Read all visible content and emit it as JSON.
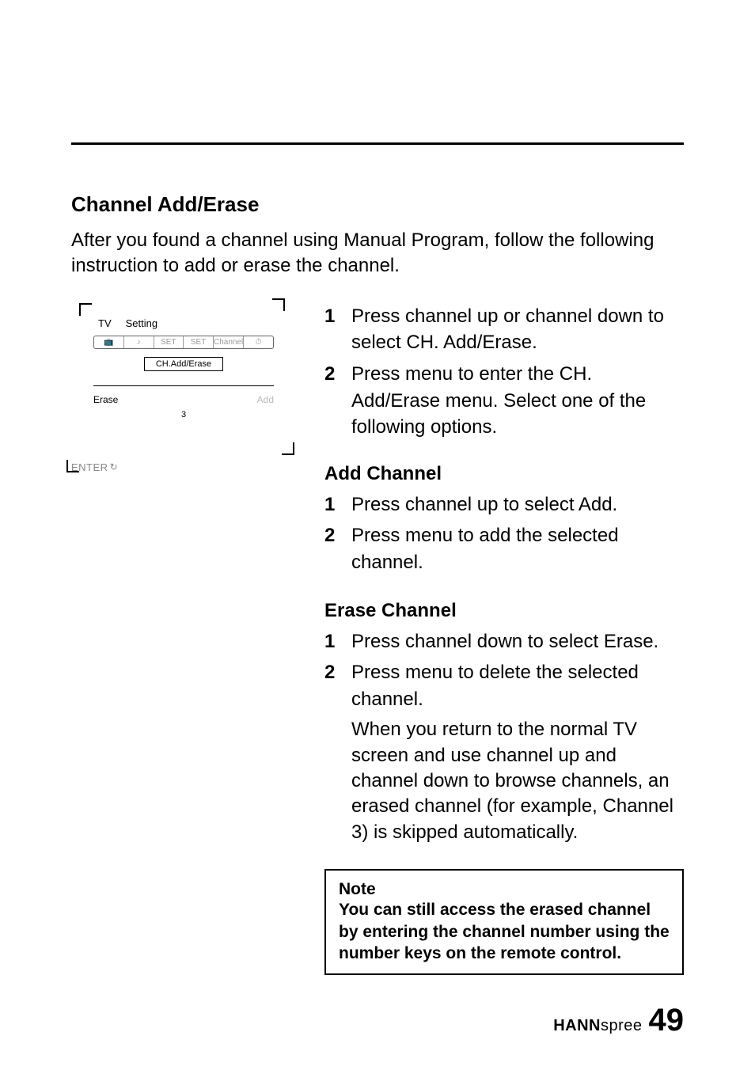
{
  "header": {
    "title": "Channel Add/Erase",
    "intro": "After you found a channel using Manual Program, follow the following instruction to add or erase the channel."
  },
  "osd": {
    "top_left": "TV",
    "top_right": "Setting",
    "icons": [
      "📺",
      "♪",
      "SET",
      "SET",
      "Channel",
      "⏱"
    ],
    "selected": "CH.Add/Erase",
    "left_label": "Erase",
    "right_label": "Add",
    "ch_num": "3",
    "enter_label": "ENTER"
  },
  "steps_main": [
    "Press channel up or channel down to select CH. Add/Erase.",
    "Press menu to enter the CH. Add/Erase menu. Select one of the following options."
  ],
  "add_section": {
    "heading": "Add Channel",
    "steps": [
      "Press channel up to select Add.",
      "Press menu to add the selected channel."
    ]
  },
  "erase_section": {
    "heading": "Erase Channel",
    "steps": [
      "Press channel down to select Erase.",
      "Press menu to delete the selected channel."
    ],
    "continuation": "When you return to the normal TV screen and use channel up and channel down to browse channels, an erased channel (for example, Channel 3) is skipped automatically."
  },
  "note": {
    "heading": "Note",
    "body": "You can still access the erased channel by entering the channel number using the number keys on the remote control."
  },
  "footer": {
    "brand_bold": "HANN",
    "brand_rest": "spree",
    "page": "49"
  }
}
